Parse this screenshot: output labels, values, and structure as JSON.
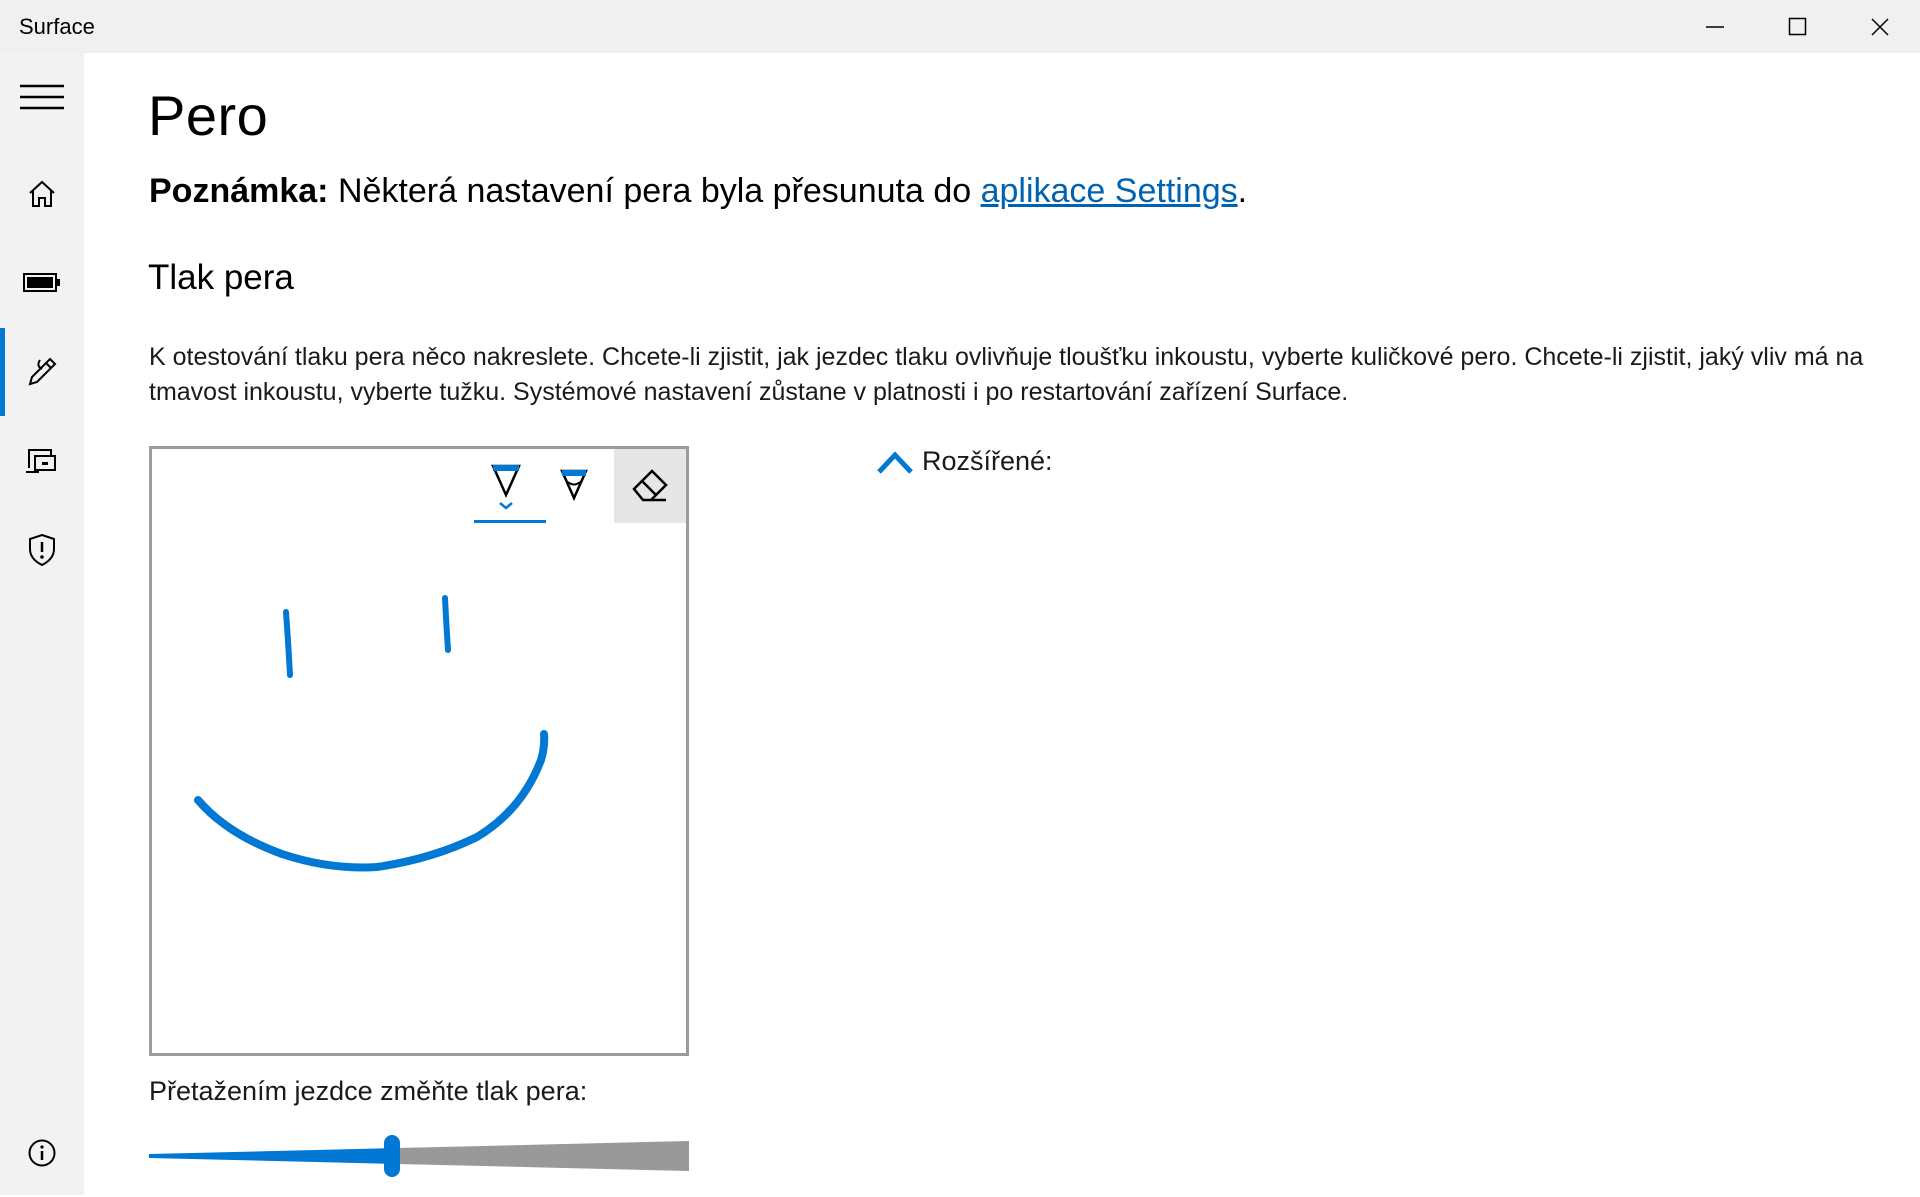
{
  "window": {
    "title": "Surface"
  },
  "nav": {
    "items": [
      {
        "name": "menu",
        "icon": "hamburger-icon"
      },
      {
        "name": "home",
        "icon": "home-icon"
      },
      {
        "name": "battery",
        "icon": "battery-icon"
      },
      {
        "name": "pen",
        "icon": "pen-icon",
        "active": true
      },
      {
        "name": "devices",
        "icon": "devices-icon"
      },
      {
        "name": "security",
        "icon": "shield-icon"
      },
      {
        "name": "info",
        "icon": "info-icon"
      }
    ]
  },
  "page": {
    "title": "Pero",
    "note_label": "Poznámka:",
    "note_text": "Některá nastavení pera byla přesunuta do",
    "note_link": "aplikace Settings",
    "note_end": ".",
    "section_title": "Tlak pera",
    "description": "K otestování tlaku pera něco nakreslete. Chcete-li zjistit, jak jezdec tlaku ovlivňuje tloušťku inkoustu, vyberte kuličkové pero. Chcete-li zjistit, jaký vliv má na tmavost inkoustu, vyberte tužku. Systémové nastavení zůstane v platnosti i po restartování zařízení Surface.",
    "advanced_label": "Rozšířené:",
    "slider_label": "Přetažením jezdce změňte tlak pera:"
  },
  "canvas": {
    "tools": [
      {
        "name": "ballpoint-pen",
        "icon": "ballpoint-pen-icon",
        "selected": true
      },
      {
        "name": "pencil",
        "icon": "pencil-icon",
        "selected": false
      },
      {
        "name": "eraser",
        "icon": "eraser-icon",
        "selected": false
      }
    ],
    "ink_color": "#0078d4"
  },
  "slider": {
    "value": 0.45
  },
  "colors": {
    "accent": "#0078d4",
    "link": "#0063b1",
    "rail_bg": "#f2f2f2",
    "titlebar_bg": "#f0f0f0",
    "track_inactive": "#999999"
  }
}
